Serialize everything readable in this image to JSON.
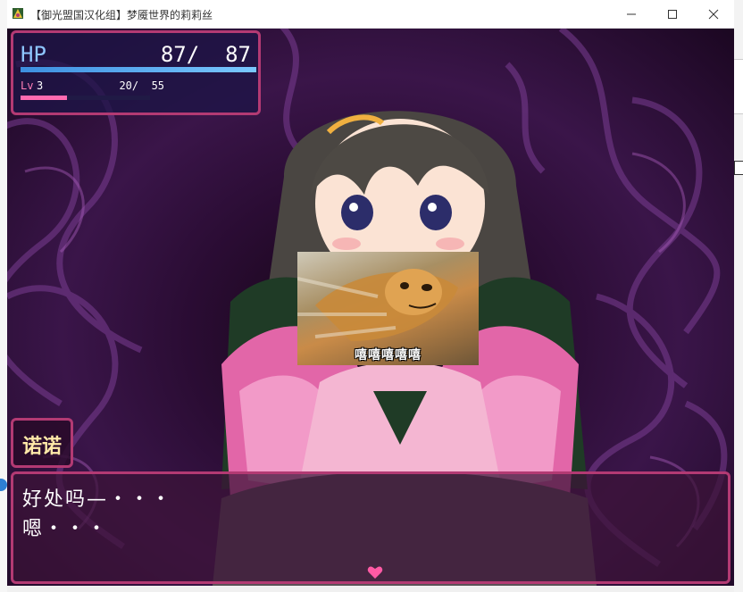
{
  "window": {
    "title": "【御光盟国汉化组】梦魇世界的莉莉丝",
    "controls": [
      "minimize",
      "maximize",
      "close"
    ]
  },
  "status": {
    "hp_label": "HP",
    "hp_value": " 87/  87",
    "hp_fraction": 1.0,
    "lv_label": "Lv",
    "lv_value": "3",
    "exp_value": "  20/  55",
    "exp_fraction": 0.36
  },
  "meme": {
    "caption": "嘻嘻嘻嘻嘻"
  },
  "dialogue": {
    "speaker": "诺诺",
    "line1": "好处吗—・・・",
    "line2": "嗯・・・"
  },
  "colors": {
    "frame": "#b33a73",
    "hp_bar": "#3d8fe0",
    "exp_bar": "#ff6ab0",
    "name_text": "#ffe9a8"
  },
  "icons": {
    "app": "game-icon",
    "pause": "heart-icon"
  }
}
